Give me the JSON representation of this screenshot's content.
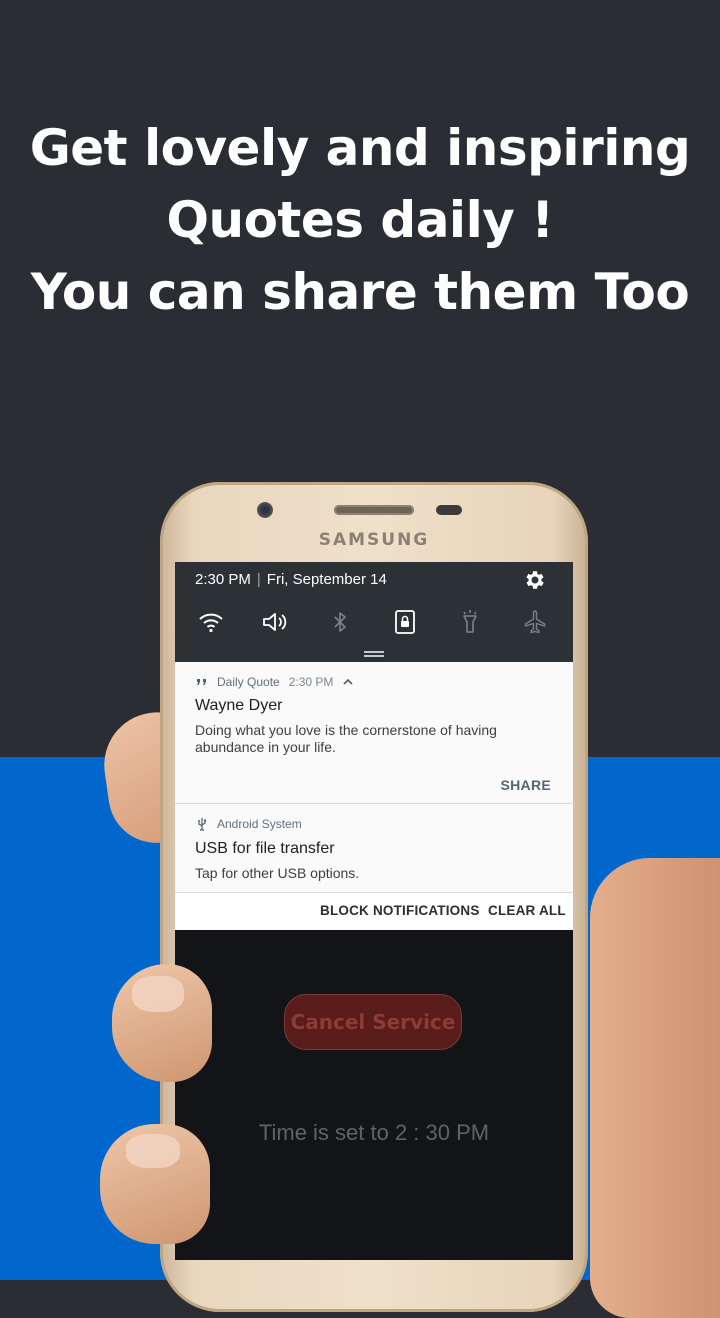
{
  "headline": {
    "line1": "Get lovely and inspiring",
    "line2": "Quotes daily !",
    "line3": "You can share them Too"
  },
  "phone": {
    "brand": "SAMSUNG"
  },
  "status_bar": {
    "time": "2:30 PM",
    "separator": "|",
    "date": "Fri, September 14"
  },
  "quick_settings": {
    "icons": [
      "wifi-icon",
      "sound-icon",
      "bluetooth-icon",
      "screen-lock-icon",
      "flashlight-icon",
      "airplane-mode-icon"
    ]
  },
  "notifications": [
    {
      "app": "Daily Quote",
      "time": "2:30 PM",
      "title": "Wayne Dyer",
      "body": "Doing what you love is the cornerstone of having abundance in your life.",
      "action": "SHARE"
    },
    {
      "app": "Android System",
      "title": "USB for file transfer",
      "body": "Tap for other USB options."
    }
  ],
  "notification_bar": {
    "block": "BLOCK NOTIFICATIONS",
    "clear": "CLEAR ALL"
  },
  "app_screen": {
    "cancel_button": "Cancel Service",
    "time_text": "Time is set to 2 : 30 PM"
  },
  "colors": {
    "top_background": "#2a2d33",
    "bottom_background": "#0167cc",
    "quick_settings_bg": "#2c3136",
    "cancel_button_bg": "#5a1c1a"
  }
}
